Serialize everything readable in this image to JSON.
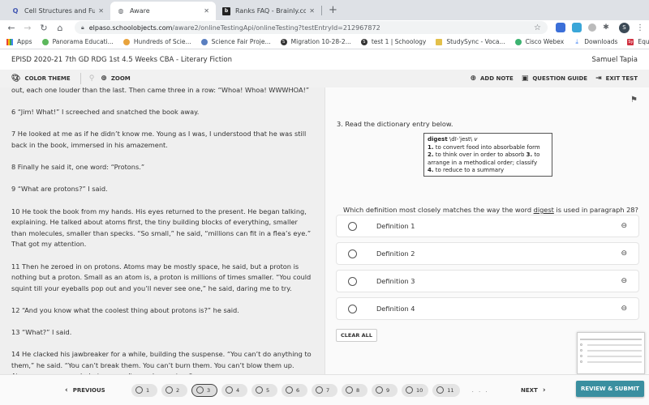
{
  "browser": {
    "tabs": [
      {
        "title": "Cell Structures and Functions",
        "icon": "quizlet-icon",
        "active": false
      },
      {
        "title": "Aware",
        "icon": "globe-icon",
        "active": true
      },
      {
        "title": "Ranks FAQ - Brainly.com",
        "icon": "brainly-icon",
        "active": false
      }
    ],
    "new_tab": "+",
    "url_host": "elpaso.schoolobjects.com",
    "url_path": "/aware2/onlineTestingApi/onlineTesting?testEntryId=212967872",
    "profile_initial": "S",
    "bookmarks": [
      {
        "label": "Apps",
        "color": "#4285f4"
      },
      {
        "label": "Panorama Educati...",
        "color": "#5cb85c"
      },
      {
        "label": "Hundreds of Scie...",
        "color": "#e8a33c"
      },
      {
        "label": "Science Fair Proje...",
        "color": "#5a7fc0"
      },
      {
        "label": "Migration 10-28-2...",
        "color": "#333333"
      },
      {
        "label": "test 1 | Schoology",
        "color": "#333333"
      },
      {
        "label": "StudySync - Voca...",
        "color": "#e3c04a"
      },
      {
        "label": "Cisco Webex",
        "color": "#3cb371"
      },
      {
        "label": "Downloads",
        "color": "#4285f4"
      },
      {
        "label": "Equation Calculat...",
        "color": "#d03040"
      }
    ]
  },
  "header": {
    "test_title": "EPISD 2020-21 7th GD RDG 1st 4.5 Weeks CBA - Literary Fiction",
    "student_name": "Samuel Tapia"
  },
  "toolbar": {
    "color_theme": "COLOR THEME",
    "zoom": "ZOOM",
    "add_note": "ADD NOTE",
    "question_guide": "QUESTION GUIDE",
    "exit_test": "EXIT TEST"
  },
  "passage": {
    "paragraphs": [
      "out, each one louder than the last. Then came three in a row: “Whoa! Whoa! WWWHOA!”",
      "6 “Jim! What!” I screeched and snatched the book away.",
      "7 He looked at me as if he didn’t know me. Young as I was, I understood that he was still back in the book, immersed in his amazement.",
      "8 Finally he said it, one word: “Protons.”",
      "9 “What are protons?” I said.",
      "10 He took the book from my hands. His eyes returned to the present. He began talking, explaining. He talked about atoms first, the tiny building blocks of everything, smaller than molecules, smaller than specks. “So small,” he said, “millions can fit in a flea’s eye.” That got my attention.",
      "11 Then he zeroed in on protons. Atoms may be mostly space, he said, but a proton is nothing but a proton. Small as an atom is, a proton is millions of times smaller. “You could squint till your eyeballs pop out and you’ll never see one,” he said, daring me to try.",
      "12 “And you know what the coolest thing about protons is?” he said.",
      "13 “What?” I said.",
      "14 He clacked his jawbreaker for a while, building the suspense. “You can’t do anything to them,” he said. “You can’t break them. You can’t burn them. You can’t blow them up. Atoms you can smash, but you can’t smash a proton.”"
    ]
  },
  "question": {
    "stem": "3. Read the dictionary entry below.",
    "dictionary": {
      "word": "digest",
      "pronunciation": "\\dī-ˈjest\\",
      "pos": "v",
      "defs": [
        {
          "num": "1.",
          "text": "to convert food into absorbable form"
        },
        {
          "num": "2.",
          "text": "to think over in order to absorb"
        },
        {
          "num": "3.",
          "text": "to arrange in a methodical order; classify"
        },
        {
          "num": "4.",
          "text": "to reduce to a summary"
        }
      ]
    },
    "prompt_before": "Which definition most closely matches the way the word ",
    "prompt_word": "digest",
    "prompt_after": " is used in paragraph 28?",
    "options": [
      "Definition 1",
      "Definition 2",
      "Definition 3",
      "Definition 4"
    ],
    "clear_all": "CLEAR ALL"
  },
  "footer": {
    "previous": "PREVIOUS",
    "next": "NEXT",
    "pages": [
      "1",
      "2",
      "3",
      "4",
      "5",
      "6",
      "7",
      "8",
      "9",
      "10",
      "11"
    ],
    "current_page": "3",
    "ellipsis": ". . .",
    "review_submit": "REVIEW & SUBMIT",
    "accent_color": "#3a8fa0"
  }
}
